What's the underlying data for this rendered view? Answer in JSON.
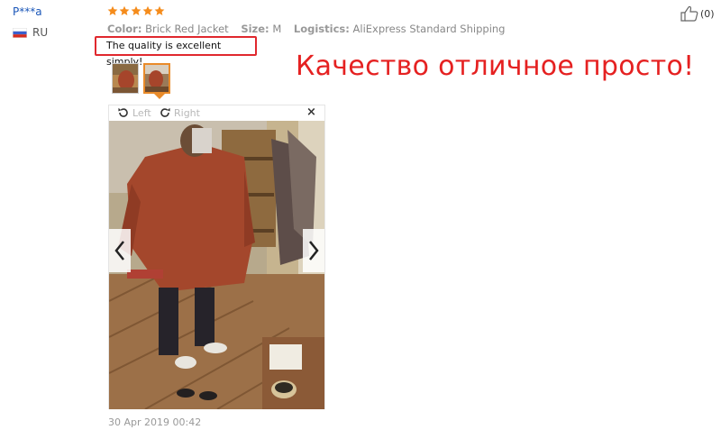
{
  "review": {
    "username": "P***a",
    "country": "RU",
    "rating": 5,
    "color_label": "Color:",
    "color_value": "Brick Red Jacket",
    "size_label": "Size:",
    "size_value": "M",
    "logistics_label": "Logistics:",
    "logistics_value": "AliExpress Standard Shipping",
    "text": "The quality is excellent simply!",
    "date": "30 Apr 2019 00:42",
    "helpful_count": "(0)"
  },
  "overlay": {
    "caption": "Качество отличное просто!"
  },
  "viewer": {
    "rotate_left_label": "Left",
    "rotate_right_label": "Right",
    "close_symbol": "×"
  },
  "colors": {
    "star": "#f58c1c",
    "highlight_border": "#e0282e",
    "caption": "#e52121",
    "username": "#1a56b8",
    "active_thumb": "#e98b2a"
  },
  "icons": [
    "thumbs-up-icon",
    "rotate-left-icon",
    "rotate-right-icon",
    "close-icon",
    "chevron-left-icon",
    "chevron-right-icon",
    "star-icon",
    "russia-flag-icon"
  ]
}
